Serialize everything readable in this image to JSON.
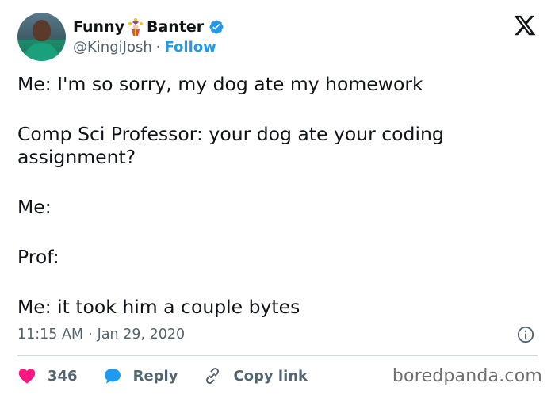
{
  "author": {
    "name_part1": "Funny",
    "name_part2": "Banter",
    "handle": "@KingiJosh",
    "separator": "·",
    "follow_label": "Follow",
    "verified": true
  },
  "tweet": {
    "lines": [
      "Me: I'm so sorry, my dog ate my homework",
      "Comp Sci Professor: your dog ate your coding assignment?",
      "Me:",
      "Prof:",
      "Me: it took him a couple bytes"
    ],
    "time": "11:15 AM",
    "time_separator": "·",
    "date": "Jan 29, 2020"
  },
  "actions": {
    "like_count": "346",
    "reply_label": "Reply",
    "copy_label": "Copy link"
  },
  "watermark": "boredpanda.com",
  "colors": {
    "accent": "#1d9bf0",
    "like": "#f91880",
    "text": "#0f1419",
    "muted": "#536471"
  }
}
